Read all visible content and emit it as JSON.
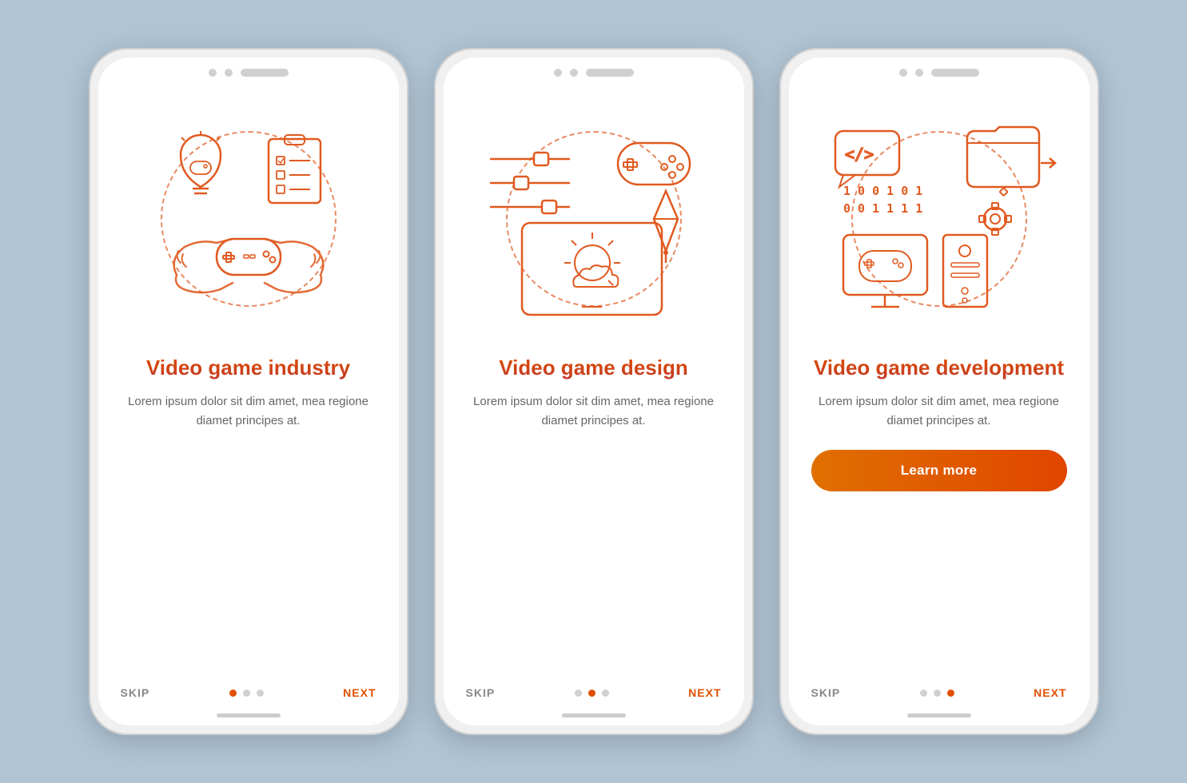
{
  "background": "#b0c4d4",
  "phones": [
    {
      "id": "phone-1",
      "title": "Video\ngame industry",
      "description": "Lorem ipsum dolor sit dim amet, mea regione diamet principes at.",
      "hasLearnMore": false,
      "dots": [
        true,
        false,
        false
      ],
      "skip_label": "SKIP",
      "next_label": "NEXT",
      "learn_more_label": ""
    },
    {
      "id": "phone-2",
      "title": "Video\ngame design",
      "description": "Lorem ipsum dolor sit dim amet, mea regione diamet principes at.",
      "hasLearnMore": false,
      "dots": [
        false,
        true,
        false
      ],
      "skip_label": "SKIP",
      "next_label": "NEXT",
      "learn_more_label": ""
    },
    {
      "id": "phone-3",
      "title": "Video game\ndevelopment",
      "description": "Lorem ipsum dolor sit dim amet, mea regione diamet principes at.",
      "hasLearnMore": true,
      "dots": [
        false,
        false,
        true
      ],
      "skip_label": "SKIP",
      "next_label": "NEXT",
      "learn_more_label": "Learn more"
    }
  ]
}
